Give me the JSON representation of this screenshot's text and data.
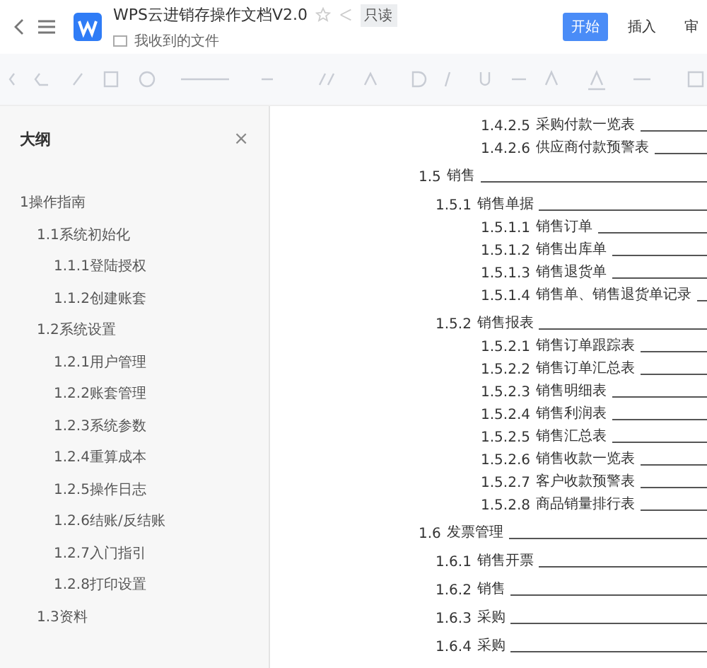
{
  "header": {
    "title": "WPS云进销存操作文档V2.0",
    "badge": "只读",
    "location": "我收到的文件",
    "tabs": [
      {
        "label": "开始",
        "selected": true
      },
      {
        "label": "插入",
        "selected": false
      },
      {
        "label": "审",
        "selected": false
      }
    ]
  },
  "outline": {
    "title": "大纲",
    "close": "×",
    "items": [
      {
        "label": "1操作指南",
        "children": [
          {
            "label": "1.1系统初始化",
            "children": [
              {
                "label": "1.1.1登陆授权"
              },
              {
                "label": "1.1.2创建账套"
              }
            ]
          },
          {
            "label": "1.2系统设置",
            "children": [
              {
                "label": "1.2.1用户管理"
              },
              {
                "label": "1.2.2账套管理"
              },
              {
                "label": "1.2.3系统参数"
              },
              {
                "label": "1.2.4重算成本"
              },
              {
                "label": "1.2.5操作日志"
              },
              {
                "label": "1.2.6结账/反结账"
              },
              {
                "label": "1.2.7入门指引"
              },
              {
                "label": "1.2.8打印设置"
              }
            ]
          },
          {
            "label": "1.3资料"
          }
        ]
      }
    ]
  },
  "toc": [
    {
      "number": "1.4.2.5",
      "title": "采购付款一览表"
    },
    {
      "number": "1.4.2.6",
      "title": "供应商付款预警表"
    },
    {
      "number": "1.5",
      "title": "销售",
      "children": [
        {
          "number": "1.5.1",
          "title": "销售单据",
          "children": [
            {
              "number": "1.5.1.1",
              "title": "销售订单"
            },
            {
              "number": "1.5.1.2",
              "title": "销售出库单"
            },
            {
              "number": "1.5.1.3",
              "title": "销售退货单"
            },
            {
              "number": "1.5.1.4",
              "title": "销售单、销售退货单记录"
            }
          ]
        },
        {
          "number": "1.5.2",
          "title": "销售报表",
          "children": [
            {
              "number": "1.5.2.1",
              "title": "销售订单跟踪表"
            },
            {
              "number": "1.5.2.2",
              "title": "销售订单汇总表"
            },
            {
              "number": "1.5.2.3",
              "title": "销售明细表"
            },
            {
              "number": "1.5.2.4",
              "title": "销售利润表"
            },
            {
              "number": "1.5.2.5",
              "title": "销售汇总表"
            },
            {
              "number": "1.5.2.6",
              "title": "销售收款一览表"
            },
            {
              "number": "1.5.2.7",
              "title": "客户收款预警表"
            },
            {
              "number": "1.5.2.8",
              "title": "商品销量排行表"
            }
          ]
        }
      ]
    },
    {
      "number": "1.6",
      "title": "发票管理",
      "children": [
        {
          "number": "1.6.1",
          "title": "销售开票"
        },
        {
          "number": "1.6.2",
          "title": "销售"
        },
        {
          "number": "1.6.3",
          "title": "采购"
        },
        {
          "number": "1.6.4",
          "title": "采购"
        }
      ]
    }
  ]
}
